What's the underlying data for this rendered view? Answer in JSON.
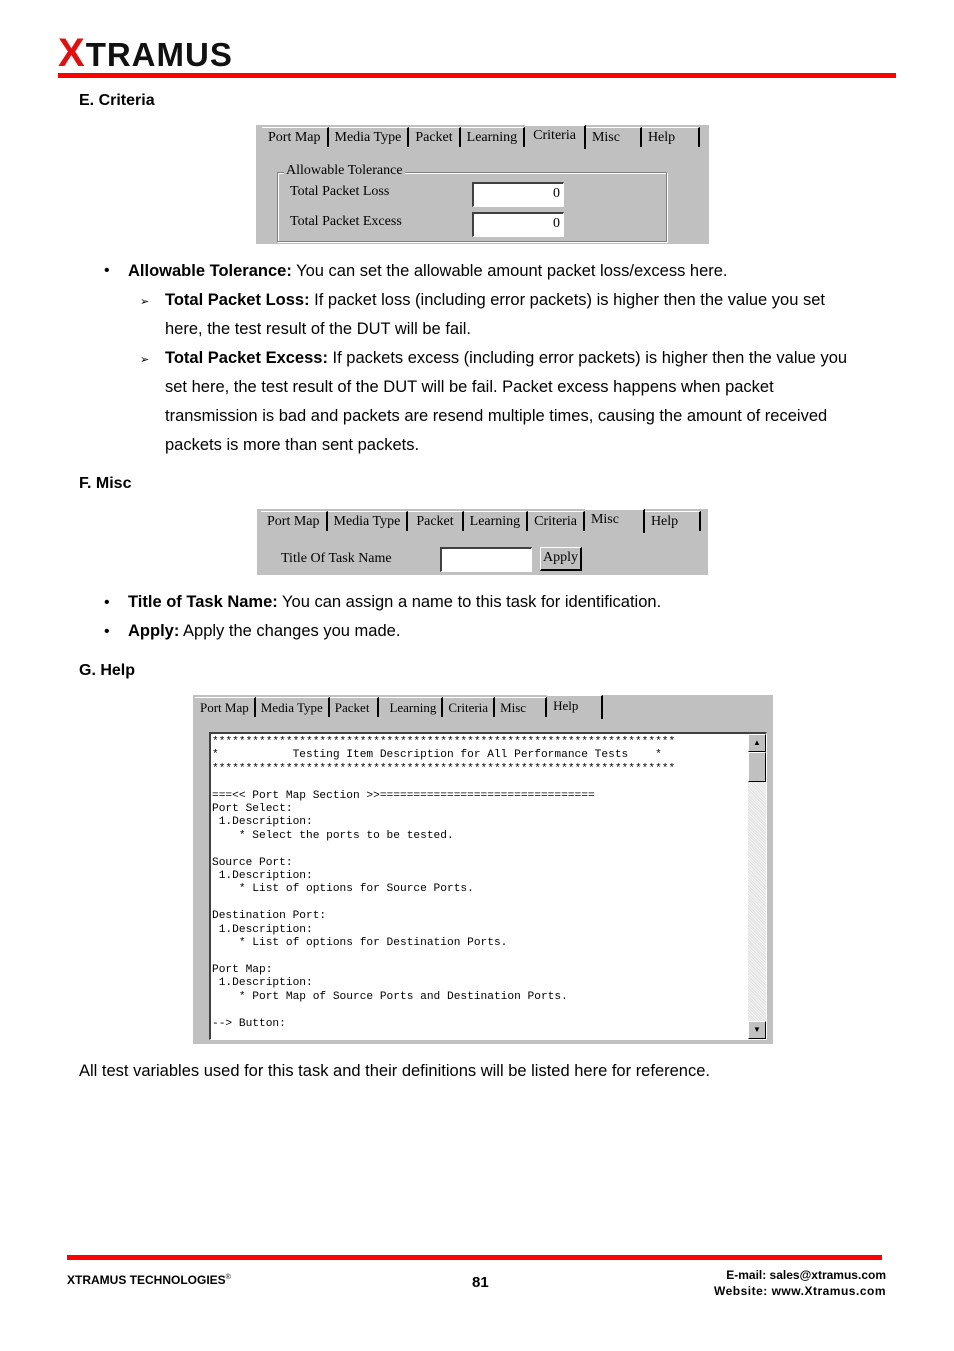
{
  "header": {
    "logo_x": "X",
    "logo_rest": "TRAMUS"
  },
  "sections": {
    "e": {
      "heading": "E. Criteria",
      "tabs": [
        "Port Map",
        "Media Type",
        "Packet",
        "Learning",
        "Criteria",
        "Misc",
        "Help"
      ],
      "active_tab": "Criteria",
      "group_label": "Allowable Tolerance",
      "fields": [
        {
          "label": "Total Packet Loss",
          "value": "0"
        },
        {
          "label": "Total Packet Excess",
          "value": "0"
        }
      ],
      "bullet": {
        "term": "Allowable Tolerance:",
        "text": " You can set the allowable amount packet loss/excess here."
      },
      "sub_items": [
        {
          "term": "Total Packet Loss:",
          "lines": [
            " If packet loss (including error packets) is higher then the value you set",
            "here, the test result of the DUT will be fail."
          ]
        },
        {
          "term": "Total Packet Excess:",
          "lines": [
            " If packets excess (including error packets) is higher then the value you",
            "set here, the test result of the DUT will be fail. Packet excess happens when packet",
            "transmission is bad and packets are resend multiple times, causing the amount of received",
            "packets is more than sent packets."
          ]
        }
      ]
    },
    "f": {
      "heading": "F. Misc",
      "tabs": [
        "Port Map",
        "Media Type",
        "Packet",
        "Learning",
        "Criteria",
        "Misc",
        "Help"
      ],
      "active_tab": "Misc",
      "task_label": "Title Of Task Name",
      "task_value": "",
      "apply_label": "Apply",
      "bullets": [
        {
          "term": "Title of Task Name:",
          "text": " You can assign a name to this task for identification."
        },
        {
          "term": "Apply:",
          "text": " Apply the changes you made."
        }
      ]
    },
    "g": {
      "heading": "G. Help",
      "tabs": [
        "Port Map",
        "Media Type",
        "Packet",
        "Learning",
        "Criteria",
        "Misc",
        "Help"
      ],
      "active_tab": "Help",
      "help_text": "*********************************************************************\n*           Testing Item Description for All Performance Tests    *\n*********************************************************************\n\n===<< Port Map Section >>================================\nPort Select:\n 1.Description:\n    * Select the ports to be tested.\n\nSource Port:\n 1.Description:\n    * List of options for Source Ports.\n\nDestination Port:\n 1.Description:\n    * List of options for Destination Ports.\n\nPort Map:\n 1.Description:\n    * Port Map of Source Ports and Destination Ports.\n\n--> Button:",
      "closing": "All test variables used for this task and their definitions will be listed here for reference."
    }
  },
  "footer": {
    "company": "XTRAMUS TECHNOLOGIES",
    "reg": "®",
    "page": "81",
    "email": "E-mail: sales@xtramus.com",
    "website": "Website:  www.Xtramus.com"
  }
}
